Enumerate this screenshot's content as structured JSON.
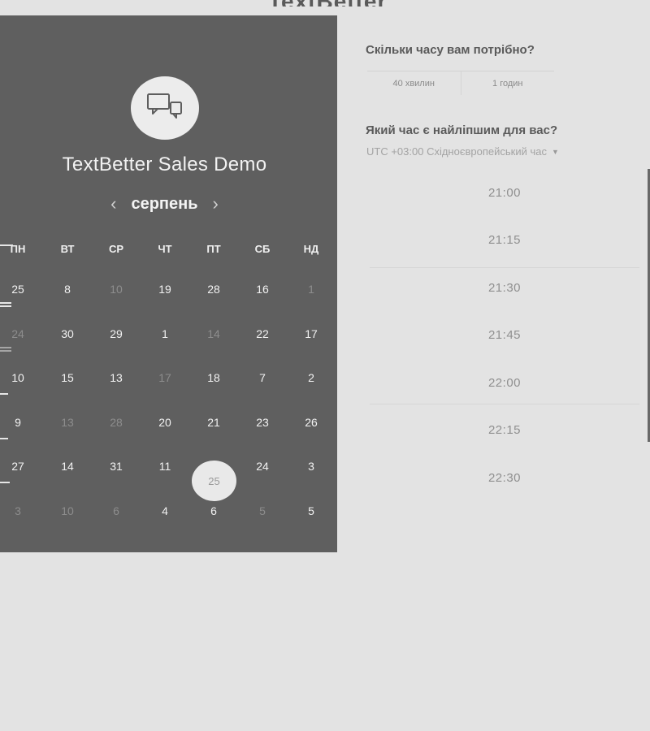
{
  "header": {
    "logo_text": "TextBetter"
  },
  "event": {
    "title": "TextBetter Sales Demo",
    "icon": "chat-bubbles-icon",
    "month": "серпень",
    "prev_icon": "‹",
    "next_icon": "›"
  },
  "calendar": {
    "weekdays": [
      "ПН",
      "ВТ",
      "СР",
      "ЧТ",
      "ПТ",
      "СБ",
      "НД"
    ],
    "weeks": [
      [
        "25",
        "8",
        "10",
        "19",
        "28",
        "16",
        "1"
      ],
      [
        "24",
        "30",
        "29",
        "1",
        "14",
        "22",
        "17"
      ],
      [
        "10",
        "15",
        "13",
        "17",
        "18",
        "7",
        "2"
      ],
      [
        "9",
        "13",
        "28",
        "20",
        "21",
        "23",
        "26"
      ],
      [
        "27",
        "14",
        "31",
        "11",
        "25",
        "24",
        "3"
      ],
      [
        "3",
        "10",
        "6",
        "4",
        "6",
        "5",
        "5"
      ]
    ],
    "muted": [
      [
        false,
        false,
        true,
        false,
        false,
        false,
        true
      ],
      [
        true,
        false,
        false,
        false,
        true,
        false,
        false
      ],
      [
        false,
        false,
        false,
        true,
        false,
        false,
        false
      ],
      [
        false,
        true,
        true,
        false,
        false,
        false,
        false
      ],
      [
        false,
        false,
        false,
        false,
        false,
        false,
        false
      ],
      [
        true,
        true,
        true,
        false,
        false,
        true,
        false
      ]
    ],
    "selected_day": "25"
  },
  "duration": {
    "heading": "Скільки часу вам потрібно?",
    "options": [
      "40 хвилин",
      "1 годин"
    ]
  },
  "time": {
    "heading": "Який час є найліпшим для вас?",
    "timezone": "UTC +03:00 Східноєвропейський час",
    "slots": [
      "21:00",
      "21:15",
      "21:30",
      "21:45",
      "22:00",
      "22:15",
      "22:30"
    ]
  }
}
